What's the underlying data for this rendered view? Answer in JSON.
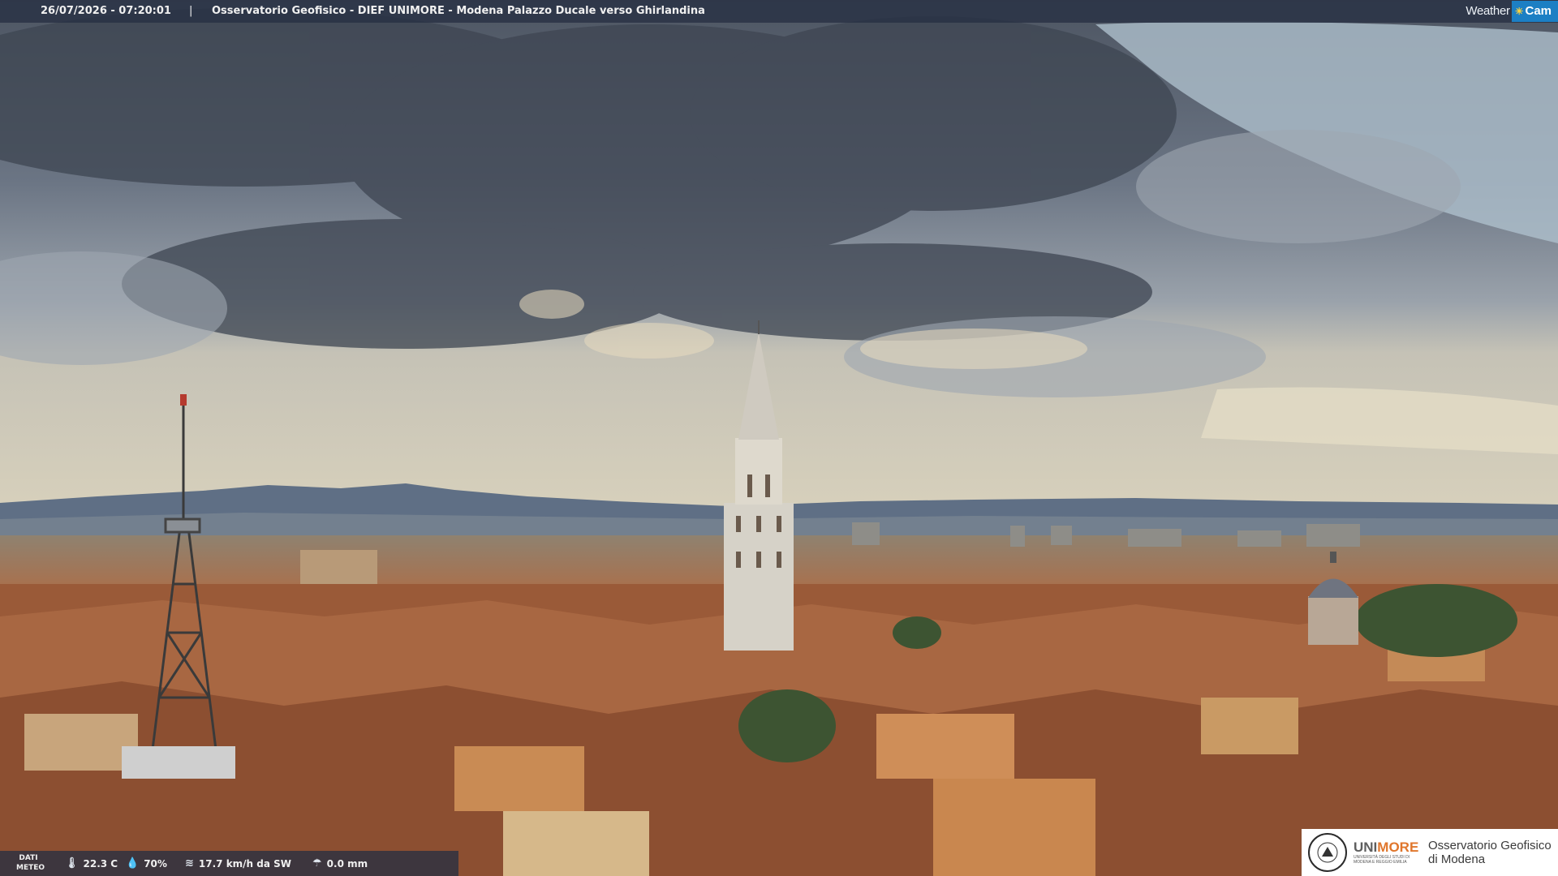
{
  "header": {
    "timestamp": "26/07/2026 - 07:20:01",
    "separator": "|",
    "title": "Osservatorio Geofisico - DIEF UNIMORE - Modena Palazzo Ducale verso Ghirlandina"
  },
  "brand": {
    "part1": "Weather",
    "part2": "Cam",
    "accent_color": "#1c7fc4"
  },
  "weather": {
    "label_line1": "DATI",
    "label_line2": "METEO",
    "temperature": "22.3 C",
    "humidity": "70%",
    "wind": "17.7 km/h da SW",
    "rain": "0.0 mm",
    "icons": [
      "thermometer-icon",
      "humidity-drop-icon",
      "wind-icon",
      "rain-icon"
    ]
  },
  "logo": {
    "uni_part1": "UNI",
    "uni_part2": "MORE",
    "uni_sub": "UNIVERSITÀ DEGLI STUDI DI MODENA E REGGIO EMILIA",
    "obs_line1": "Osservatorio Geofisico",
    "obs_line2": "di Modena"
  }
}
